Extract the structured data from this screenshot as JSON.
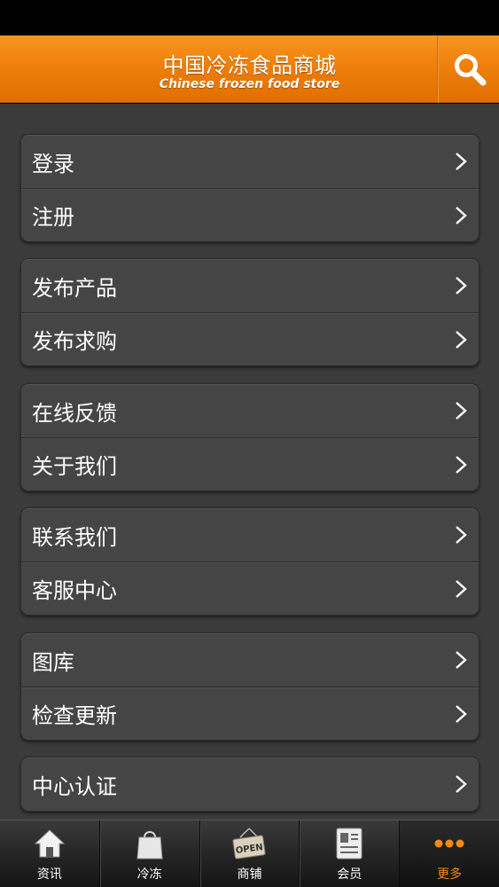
{
  "header": {
    "title": "中国冷冻食品商城",
    "subtitle": "Chinese frozen food store",
    "search_icon": "search-icon"
  },
  "menu_groups": [
    {
      "items": [
        {
          "label": "登录"
        },
        {
          "label": "注册"
        }
      ]
    },
    {
      "items": [
        {
          "label": "发布产品"
        },
        {
          "label": "发布求购"
        }
      ]
    },
    {
      "items": [
        {
          "label": "在线反馈"
        },
        {
          "label": "关于我们"
        }
      ]
    },
    {
      "items": [
        {
          "label": "联系我们"
        },
        {
          "label": "客服中心"
        }
      ]
    },
    {
      "items": [
        {
          "label": "图库"
        },
        {
          "label": "检查更新"
        }
      ]
    },
    {
      "items": [
        {
          "label": "中心认证"
        }
      ]
    }
  ],
  "tabbar": {
    "tabs": [
      {
        "label": "资讯",
        "icon": "home-icon"
      },
      {
        "label": "冷冻",
        "icon": "shopping-bag-icon"
      },
      {
        "label": "商铺",
        "icon": "open-sign-icon",
        "sign_text": "OPEN"
      },
      {
        "label": "会员",
        "icon": "member-card-icon"
      },
      {
        "label": "更多",
        "icon": "more-dots-icon",
        "active": true
      }
    ]
  },
  "colors": {
    "accent": "#f28a17",
    "header": "#ec7c08",
    "background": "#3b3b3b",
    "group": "#454545"
  }
}
